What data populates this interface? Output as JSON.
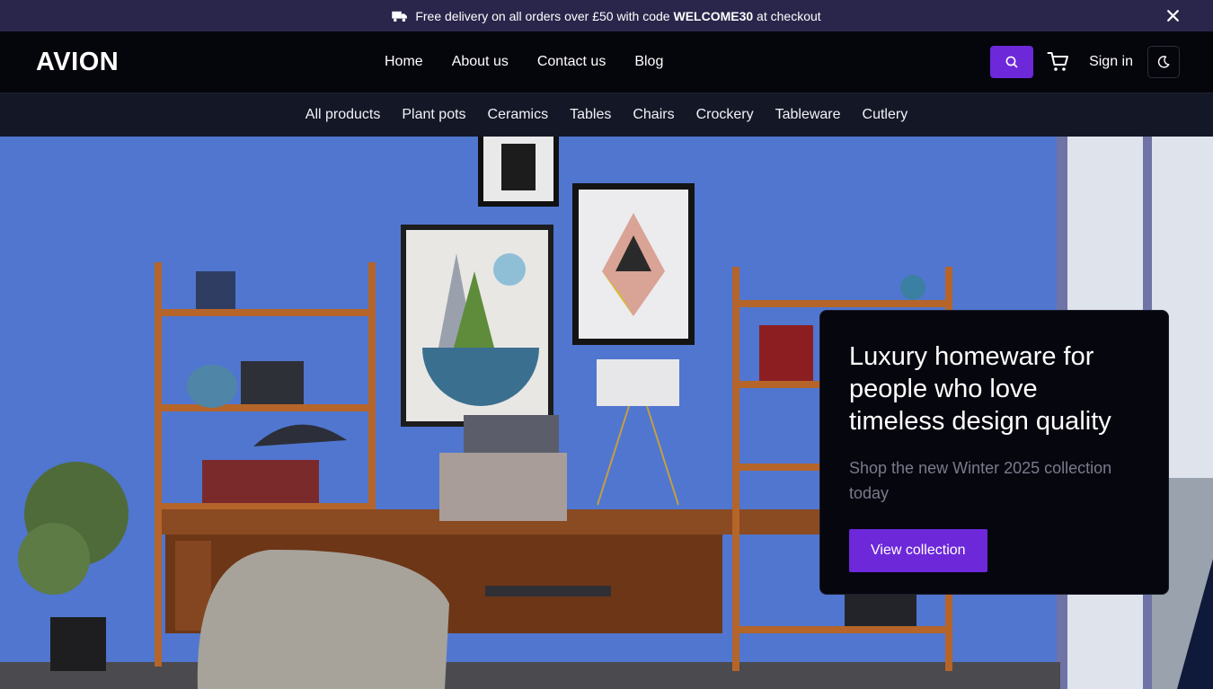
{
  "announcement": {
    "text_before": "Free delivery on all orders over £50 with code ",
    "code": "WELCOME30",
    "text_after": " at checkout"
  },
  "header": {
    "logo": "AVION",
    "nav": [
      "Home",
      "About us",
      "Contact us",
      "Blog"
    ],
    "sign_in": "Sign in"
  },
  "categories": [
    "All products",
    "Plant pots",
    "Ceramics",
    "Tables",
    "Chairs",
    "Crockery",
    "Tableware",
    "Cutlery"
  ],
  "hero": {
    "title": "Luxury homeware for people who love timeless design quality",
    "subtitle": "Shop the new Winter 2025 collection today",
    "cta": "View collection"
  },
  "colors": {
    "accent": "#6d28d9",
    "announcement_bg": "#2a254b",
    "header_bg": "#05050c",
    "catnav_bg": "#141826",
    "wall": "#4e72cd"
  },
  "icons": [
    "truck-icon",
    "close-icon",
    "search-icon",
    "cart-icon",
    "moon-icon"
  ]
}
